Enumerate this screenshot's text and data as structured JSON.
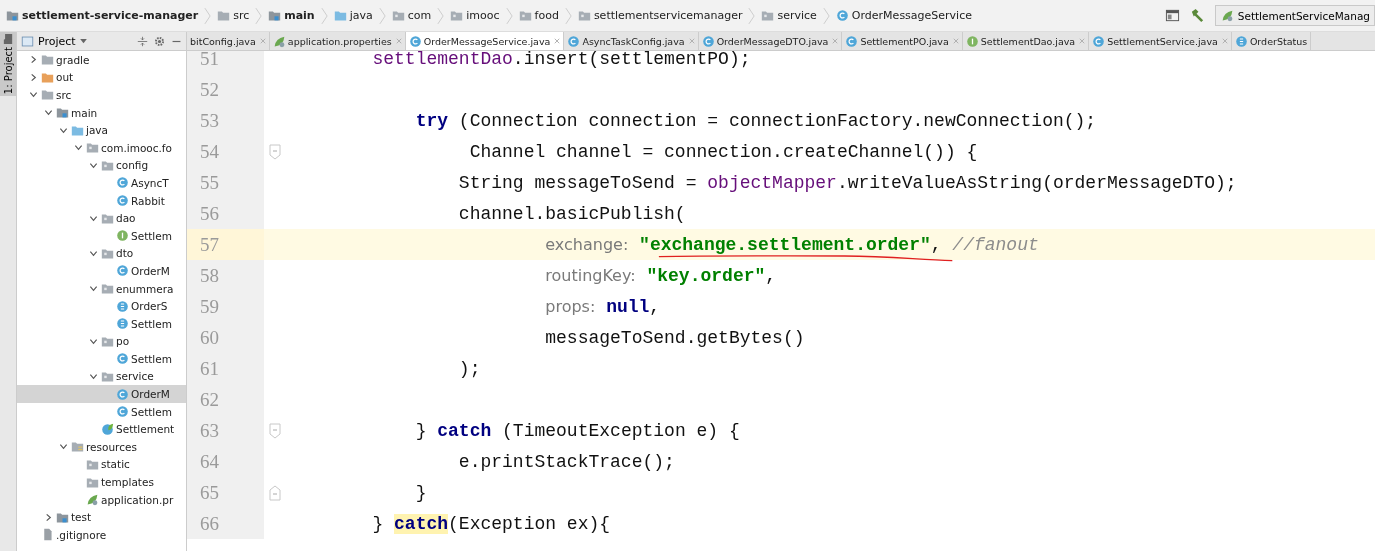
{
  "breadcrumbs": [
    {
      "label": "settlement-service-manager",
      "kind": "module",
      "emphasized": true
    },
    {
      "label": "src",
      "kind": "folder",
      "emphasized": false
    },
    {
      "label": "main",
      "kind": "module",
      "emphasized": true
    },
    {
      "label": "java",
      "kind": "source-folder",
      "emphasized": false
    },
    {
      "label": "com",
      "kind": "package",
      "emphasized": false
    },
    {
      "label": "imooc",
      "kind": "package",
      "emphasized": false
    },
    {
      "label": "food",
      "kind": "package",
      "emphasized": false
    },
    {
      "label": "settlementservicemanager",
      "kind": "package",
      "emphasized": false
    },
    {
      "label": "service",
      "kind": "package",
      "emphasized": false
    },
    {
      "label": "OrderMessageService",
      "kind": "class",
      "emphasized": false
    }
  ],
  "run_config": {
    "label": "SettlementServiceManag"
  },
  "tool_window_stripe": {
    "label": "1: Project"
  },
  "project_panel": {
    "title": "Project"
  },
  "project_tree": [
    {
      "label": "gradle",
      "kind": "folder",
      "expanded": false,
      "selected": false
    },
    {
      "label": "out",
      "kind": "excluded-folder",
      "expanded": false,
      "selected": false
    },
    {
      "label": "src",
      "kind": "folder",
      "expanded": true,
      "selected": false,
      "children": [
        {
          "label": "main",
          "kind": "module",
          "expanded": true,
          "selected": false,
          "children": [
            {
              "label": "java",
              "kind": "source-folder",
              "expanded": true,
              "selected": false,
              "children": [
                {
                  "label": "com.imooc.fo",
                  "kind": "package",
                  "expanded": true,
                  "selected": false,
                  "children": [
                    {
                      "label": "config",
                      "kind": "package",
                      "expanded": true,
                      "selected": false,
                      "children": [
                        {
                          "label": "AsyncT",
                          "kind": "class",
                          "selected": false
                        },
                        {
                          "label": "Rabbit",
                          "kind": "class",
                          "selected": false
                        }
                      ]
                    },
                    {
                      "label": "dao",
                      "kind": "package",
                      "expanded": true,
                      "selected": false,
                      "children": [
                        {
                          "label": "Settlem",
                          "kind": "interface",
                          "selected": false
                        }
                      ]
                    },
                    {
                      "label": "dto",
                      "kind": "package",
                      "expanded": true,
                      "selected": false,
                      "children": [
                        {
                          "label": "OrderM",
                          "kind": "class",
                          "selected": false
                        }
                      ]
                    },
                    {
                      "label": "enummera",
                      "kind": "package",
                      "expanded": true,
                      "selected": false,
                      "children": [
                        {
                          "label": "OrderS",
                          "kind": "enum",
                          "selected": false
                        },
                        {
                          "label": "Settlem",
                          "kind": "enum",
                          "selected": false
                        }
                      ]
                    },
                    {
                      "label": "po",
                      "kind": "package",
                      "expanded": true,
                      "selected": false,
                      "children": [
                        {
                          "label": "Settlem",
                          "kind": "class",
                          "selected": false
                        }
                      ]
                    },
                    {
                      "label": "service",
                      "kind": "package",
                      "expanded": true,
                      "selected": false,
                      "children": [
                        {
                          "label": "OrderM",
                          "kind": "class",
                          "selected": true
                        },
                        {
                          "label": "Settlem",
                          "kind": "class",
                          "selected": false
                        }
                      ]
                    },
                    {
                      "label": "Settlement",
                      "kind": "app",
                      "selected": false
                    }
                  ]
                }
              ]
            },
            {
              "label": "resources",
              "kind": "resources-folder",
              "expanded": true,
              "selected": false,
              "children": [
                {
                  "label": "static",
                  "kind": "package",
                  "selected": false
                },
                {
                  "label": "templates",
                  "kind": "package",
                  "selected": false
                },
                {
                  "label": "application.pr",
                  "kind": "properties",
                  "selected": false
                }
              ]
            }
          ]
        },
        {
          "label": "test",
          "kind": "module",
          "expanded": false,
          "selected": false
        }
      ]
    },
    {
      "label": ".gitignore",
      "kind": "file",
      "selected": false
    }
  ],
  "tabs": [
    {
      "label": "bitConfig.java",
      "kind": "none",
      "selected": false
    },
    {
      "label": "application.properties",
      "kind": "properties",
      "selected": false
    },
    {
      "label": "OrderMessageService.java",
      "kind": "class",
      "selected": true
    },
    {
      "label": "AsyncTaskConfig.java",
      "kind": "class",
      "selected": false
    },
    {
      "label": "OrderMessageDTO.java",
      "kind": "class",
      "selected": false
    },
    {
      "label": "SettlementPO.java",
      "kind": "class",
      "selected": false
    },
    {
      "label": "SettlementDao.java",
      "kind": "interface",
      "selected": false
    },
    {
      "label": "SettlementService.java",
      "kind": "class",
      "selected": false
    },
    {
      "label": "OrderStatus",
      "kind": "enum",
      "selected": false
    }
  ],
  "code_lines": [
    {
      "number": "51",
      "current": false,
      "kind": "plain",
      "tokens": [
        {
          "text": "        settlementDao",
          "kind": "field"
        },
        {
          "text": ".insert(settlementPO);",
          "kind": "plain"
        }
      ]
    },
    {
      "number": "52",
      "current": false,
      "kind": "plain"
    },
    {
      "number": "53",
      "current": false,
      "kind": "plain",
      "tokens": [
        {
          "text": "            try",
          "kind": "keyword"
        },
        {
          "text": " (Connection connection = connectionFactory.newConnection();",
          "kind": "plain"
        }
      ]
    },
    {
      "number": "54",
      "current": false,
      "kind": "fold-start",
      "tokens": [
        {
          "text": "                 Channel channel = connection.createChannel()) {",
          "kind": "plain"
        }
      ]
    },
    {
      "number": "55",
      "current": false,
      "kind": "plain",
      "tokens": [
        {
          "text": "                String messageToSend = ",
          "kind": "plain"
        },
        {
          "text": "objectMapper",
          "kind": "field"
        },
        {
          "text": ".writeValueAsString(orderMessageDTO);",
          "kind": "plain"
        }
      ]
    },
    {
      "number": "56",
      "current": false,
      "kind": "plain",
      "tokens": [
        {
          "text": "                channel.basicPublish(",
          "kind": "plain"
        }
      ]
    },
    {
      "number": "57",
      "current": true,
      "kind": "plain",
      "tokens": [
        {
          "text": "                        exchange:",
          "kind": "hint"
        },
        {
          "text": " \"exchange.settlement.order\"",
          "kind": "string"
        },
        {
          "text": ", ",
          "kind": "plain"
        },
        {
          "text": "//fanout",
          "kind": "comment"
        }
      ]
    },
    {
      "number": "58",
      "current": false,
      "kind": "plain",
      "tokens": [
        {
          "text": "                        routingKey:",
          "kind": "hint"
        },
        {
          "text": " \"key.order\"",
          "kind": "string"
        },
        {
          "text": ",",
          "kind": "plain"
        }
      ]
    },
    {
      "number": "59",
      "current": false,
      "kind": "plain",
      "tokens": [
        {
          "text": "                        props:",
          "kind": "hint"
        },
        {
          "text": " null",
          "kind": "keyword"
        },
        {
          "text": ",",
          "kind": "plain"
        }
      ]
    },
    {
      "number": "60",
      "current": false,
      "kind": "plain",
      "tokens": [
        {
          "text": "                        messageToSend.getBytes()",
          "kind": "plain"
        }
      ]
    },
    {
      "number": "61",
      "current": false,
      "kind": "plain",
      "tokens": [
        {
          "text": "                );",
          "kind": "plain"
        }
      ]
    },
    {
      "number": "62",
      "current": false,
      "kind": "plain"
    },
    {
      "number": "63",
      "current": false,
      "kind": "fold-start",
      "tokens": [
        {
          "text": "            } ",
          "kind": "plain"
        },
        {
          "text": "catch",
          "kind": "keyword"
        },
        {
          "text": " (TimeoutException e) {",
          "kind": "plain"
        }
      ]
    },
    {
      "number": "64",
      "current": false,
      "kind": "plain",
      "tokens": [
        {
          "text": "                e.printStackTrace();",
          "kind": "plain"
        }
      ]
    },
    {
      "number": "65",
      "current": false,
      "kind": "fold-end",
      "tokens": [
        {
          "text": "            }",
          "kind": "plain"
        }
      ]
    },
    {
      "number": "66",
      "current": false,
      "kind": "plain",
      "tokens": [
        {
          "text": "        } ",
          "kind": "plain"
        },
        {
          "text": "catch",
          "kind": "match"
        },
        {
          "text": "(Exception ex){",
          "kind": "plain"
        }
      ]
    }
  ]
}
